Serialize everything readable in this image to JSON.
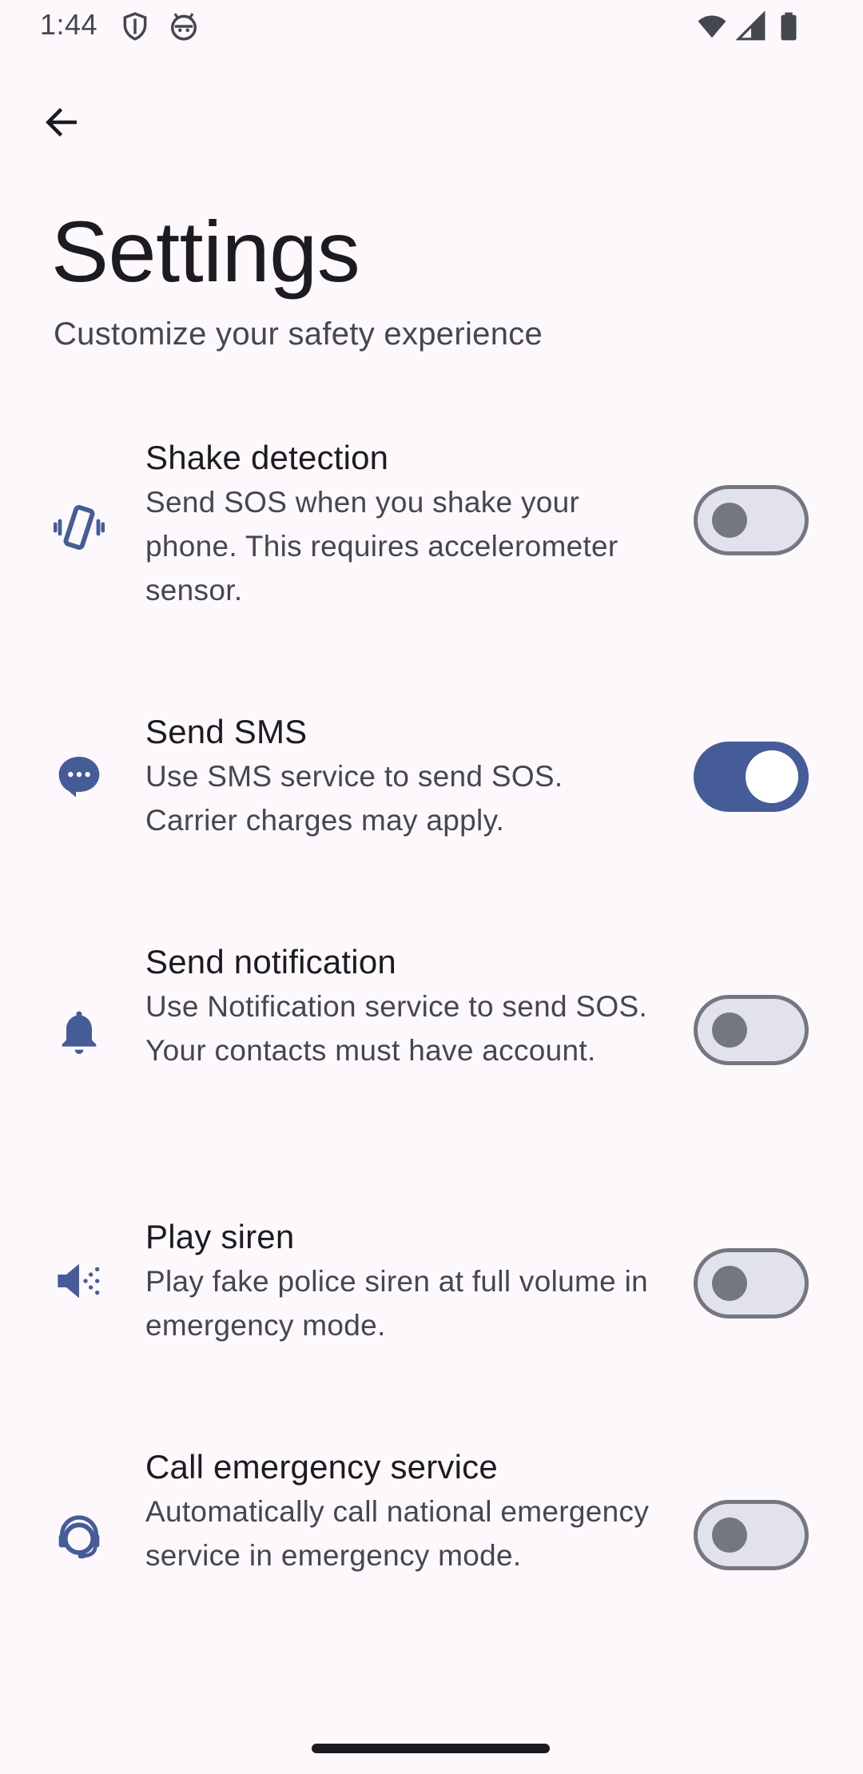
{
  "status_bar": {
    "time": "1:44",
    "icons": [
      "shield-icon",
      "android-face-icon",
      "wifi-icon",
      "cellular-signal-icon",
      "battery-icon"
    ]
  },
  "toolbar": {
    "back_icon": "arrow-back-icon"
  },
  "header": {
    "title": "Settings",
    "subtitle": "Customize your safety experience"
  },
  "settings": [
    {
      "id": "shake",
      "icon": "vibration-icon",
      "title": "Shake detection",
      "description": "Send SOS when you shake your phone. This requires accelerometer sensor.",
      "enabled": false
    },
    {
      "id": "sms",
      "icon": "sms-icon",
      "title": "Send SMS",
      "description": "Use SMS service to send SOS. Carrier charges may apply.",
      "enabled": true
    },
    {
      "id": "notification",
      "icon": "notification-bell-icon",
      "title": "Send notification",
      "description": "Use Notification service to send SOS. Your contacts must have account.",
      "enabled": false
    },
    {
      "id": "siren",
      "icon": "speaker-siren-icon",
      "title": "Play siren",
      "description": "Play fake police siren at full volume in emergency mode.",
      "enabled": false
    },
    {
      "id": "call",
      "icon": "support-agent-icon",
      "title": "Call emergency service",
      "description": "Automatically call national emergency service in emergency mode.",
      "enabled": false
    }
  ],
  "colors": {
    "background": "#FCF8FC",
    "primary": "#465C98",
    "switch_off_track": "#E1E2EC",
    "switch_outline": "#74777F",
    "text_primary": "#1C1B1F",
    "text_secondary": "#44474E"
  }
}
